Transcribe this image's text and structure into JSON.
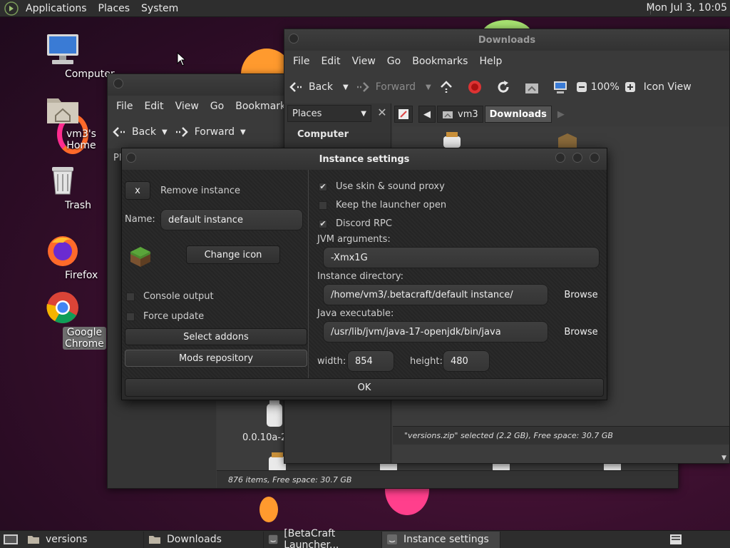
{
  "top_panel": {
    "menus": [
      "Applications",
      "Places",
      "System"
    ],
    "clock": "Mon Jul  3, 10:05"
  },
  "desktop_icons": [
    {
      "label": "Computer",
      "icon": "computer-icon"
    },
    {
      "label": "vm3's Home",
      "icon": "home-folder-icon"
    },
    {
      "label": "Trash",
      "icon": "trash-icon"
    },
    {
      "label": "Firefox",
      "icon": "firefox-icon"
    },
    {
      "label": "Google Chrome",
      "icon": "chrome-icon",
      "selected": true
    }
  ],
  "downloads_window": {
    "title": "Downloads",
    "menus": [
      "File",
      "Edit",
      "View",
      "Go",
      "Bookmarks",
      "Help"
    ],
    "toolbar": {
      "back": "Back",
      "forward": "Forward",
      "zoom": "100%",
      "view_mode": "Icon View"
    },
    "places_label": "Places",
    "sidebar_heading": "Computer",
    "breadcrumbs": [
      "vm3",
      "Downloads"
    ],
    "status": "\"versions.zip\" selected (2.2 GB), Free space: 30.7 GB"
  },
  "versions_window": {
    "menus": [
      "File",
      "Edit",
      "View",
      "Go",
      "Bookmarks"
    ],
    "toolbar": {
      "back": "Back",
      "forward": "Forward"
    },
    "places_partial": "Pl",
    "file_label": "0.0.10a-2",
    "status": "876 items, Free space: 30.7 GB"
  },
  "instance_settings": {
    "title": "Instance settings",
    "remove_button": "x",
    "remove_label": "Remove instance",
    "name_label": "Name:",
    "name_value": "default instance",
    "change_icon": "Change icon",
    "console_output": {
      "label": "Console output",
      "checked": false
    },
    "force_update": {
      "label": "Force update",
      "checked": false
    },
    "select_addons": "Select addons",
    "mods_repository": "Mods repository",
    "use_skin_proxy": {
      "label": "Use skin & sound proxy",
      "checked": true
    },
    "keep_launcher_open": {
      "label": "Keep the launcher open",
      "checked": false
    },
    "discord_rpc": {
      "label": "Discord RPC",
      "checked": true
    },
    "jvm_label": "JVM arguments:",
    "jvm_value": "-Xmx1G",
    "dir_label": "Instance directory:",
    "dir_value": "/home/vm3/.betacraft/default instance/",
    "java_label": "Java executable:",
    "java_value": "/usr/lib/jvm/java-17-openjdk/bin/java",
    "browse": "Browse",
    "width_label": "width:",
    "width_value": "854",
    "height_label": "height:",
    "height_value": "480",
    "ok": "OK"
  },
  "taskbar": [
    {
      "label": "versions",
      "icon": "folder-icon"
    },
    {
      "label": "Downloads",
      "icon": "folder-icon"
    },
    {
      "label": "[BetaCraft Launcher...",
      "icon": "java-icon"
    },
    {
      "label": "Instance settings",
      "icon": "java-icon",
      "active": true
    }
  ],
  "colors": {
    "accent_orange": "#ff8a2a",
    "accent_pink": "#ff3da0",
    "green": "#8fdc5a",
    "window_bg": "#3a3a3a"
  }
}
